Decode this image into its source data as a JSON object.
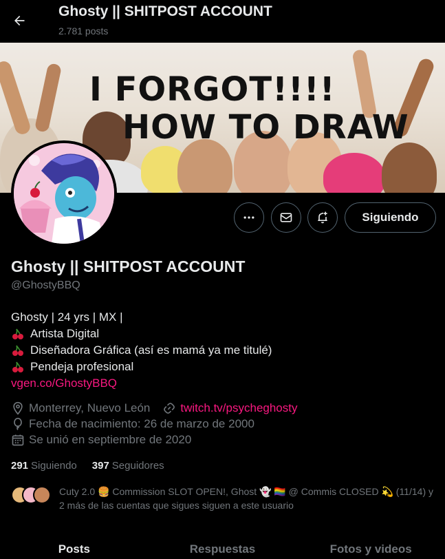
{
  "header": {
    "title": "Ghosty || SHITPOST ACCOUNT",
    "post_count": "2.781 posts"
  },
  "banner": {
    "line1": "I FORGOT!!!!",
    "line2": "HOW TO DRAW"
  },
  "actions": {
    "follow_label": "Siguiendo"
  },
  "profile": {
    "name": "Ghosty || SHITPOST ACCOUNT",
    "handle": "@GhostyBBQ",
    "bio_line1": "Ghosty | 24 yrs | MX |",
    "bio_line2": "Artista Digital",
    "bio_line3": "Diseñadora Gráfica (así es mamá ya me titulé)",
    "bio_line4": "Pendeja profesional",
    "bio_link": "vgen.co/GhostyBBQ",
    "location": "Monterrey, Nuevo León",
    "website": "twitch.tv/psycheghosty",
    "birthday": "Fecha de nacimiento: 26 de marzo de 2000",
    "joined": "Se unió en septiembre de 2020"
  },
  "stats": {
    "following_count": "291",
    "following_label": "Siguiendo",
    "followers_count": "397",
    "followers_label": "Seguidores"
  },
  "followed_by": {
    "text": "Cuty 2.0 🍔 Commission SLOT OPEN!, Ghost 👻 🏳️‍🌈 @ Commis CLOSED 💫 (11/14) y 2 más de las cuentas que sigues siguen a este usuario"
  },
  "tabs": [
    "Posts",
    "Respuestas",
    "Fotos y videos"
  ],
  "colors": {
    "accent": "#f91880",
    "muted": "#71767b",
    "text": "#e7e9ea",
    "background": "#000000"
  }
}
